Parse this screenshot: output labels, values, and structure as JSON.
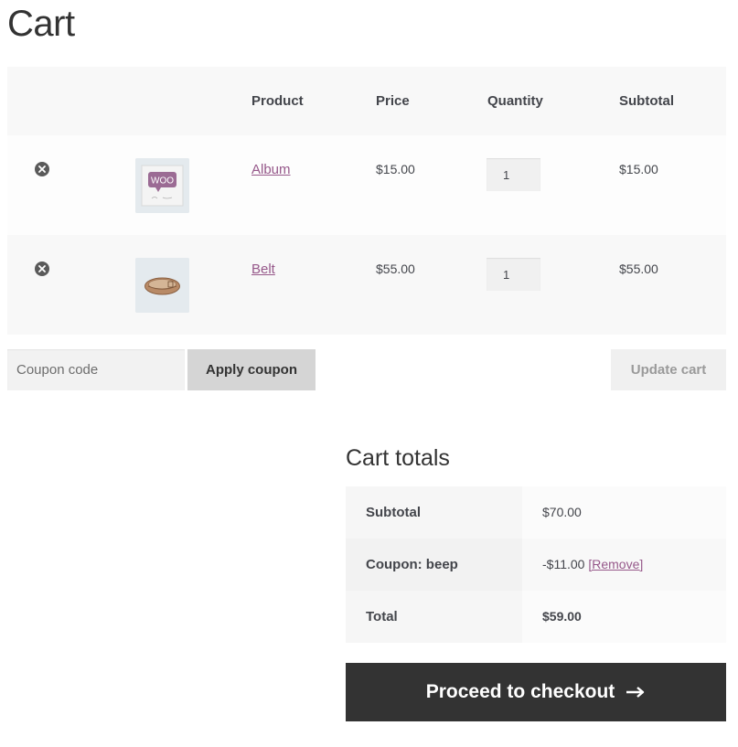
{
  "page": {
    "title": "Cart"
  },
  "table": {
    "headers": {
      "product": "Product",
      "price": "Price",
      "quantity": "Quantity",
      "subtotal": "Subtotal"
    },
    "rows": [
      {
        "name": "Album",
        "price": "$15.00",
        "quantity": "1",
        "subtotal": "$15.00",
        "thumb_text": "WOO",
        "remove_icon": "remove-circle-icon"
      },
      {
        "name": "Belt",
        "price": "$55.00",
        "quantity": "1",
        "subtotal": "$55.00",
        "remove_icon": "remove-circle-icon"
      }
    ]
  },
  "coupon": {
    "placeholder": "Coupon code",
    "apply_label": "Apply coupon"
  },
  "update_label": "Update cart",
  "totals": {
    "title": "Cart totals",
    "subtotal_label": "Subtotal",
    "subtotal_value": "$70.00",
    "coupon_label": "Coupon: beep",
    "coupon_value": "-$11.00",
    "coupon_remove": "[Remove]",
    "total_label": "Total",
    "total_value": "$59.00"
  },
  "checkout_label": "Proceed to checkout",
  "colors": {
    "accent": "#96588a",
    "dark_button": "#333333"
  }
}
